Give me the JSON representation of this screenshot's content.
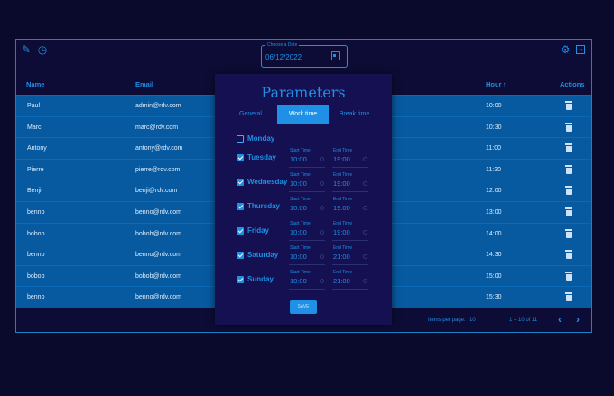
{
  "toolbar": {
    "edit_icon": "pencil-icon",
    "history_icon": "history-icon",
    "settings_icon": "gear-icon",
    "logout_icon": "logout-icon"
  },
  "date_picker": {
    "label": "Choose a Date",
    "value": "06/12/2022"
  },
  "table": {
    "headers": {
      "name": "Name",
      "email": "Email",
      "hour": "Hour",
      "hour_sort": "↑",
      "actions": "Actions"
    },
    "rows": [
      {
        "name": "Paul",
        "email": "admin@rdv.com",
        "hour": "10:00"
      },
      {
        "name": "Marc",
        "email": "marc@rdv.com",
        "hour": "10:30"
      },
      {
        "name": "Antony",
        "email": "antony@rdv.com",
        "hour": "11:00"
      },
      {
        "name": "Pierre",
        "email": "pierre@rdv.com",
        "hour": "11:30"
      },
      {
        "name": "Benji",
        "email": "benji@rdv.com",
        "hour": "12:00"
      },
      {
        "name": "benno",
        "email": "benno@rdv.com",
        "hour": "13:00"
      },
      {
        "name": "bobob",
        "email": "bobob@rdv.com",
        "hour": "14:00"
      },
      {
        "name": "benno",
        "email": "benno@rdv.com",
        "hour": "14:30"
      },
      {
        "name": "bobob",
        "email": "bobob@rdv.com",
        "hour": "15:00"
      },
      {
        "name": "benno",
        "email": "benno@rdv.com",
        "hour": "15:30"
      }
    ]
  },
  "paginator": {
    "items_label": "Items per page:",
    "page_size": "10",
    "range": "1 – 10 of 11",
    "prev": "‹",
    "next": "›"
  },
  "modal": {
    "title": "Parameters",
    "tabs": [
      "General",
      "Work time",
      "Break time"
    ],
    "active_tab": "Work time",
    "start_label": "Start Time",
    "end_label": "End Time",
    "days": [
      {
        "label": "Monday",
        "checked": false
      },
      {
        "label": "Tuesday",
        "checked": true,
        "start": "10:00",
        "end": "19:00"
      },
      {
        "label": "Wednesday",
        "checked": true,
        "start": "10:00",
        "end": "19:00"
      },
      {
        "label": "Thursday",
        "checked": true,
        "start": "10:00",
        "end": "19:00"
      },
      {
        "label": "Friday",
        "checked": true,
        "start": "10:00",
        "end": "19:00"
      },
      {
        "label": "Saturday",
        "checked": true,
        "start": "10:00",
        "end": "21:00"
      },
      {
        "label": "Sunday",
        "checked": true,
        "start": "10:00",
        "end": "21:00"
      }
    ],
    "save_label": "SAVE"
  }
}
